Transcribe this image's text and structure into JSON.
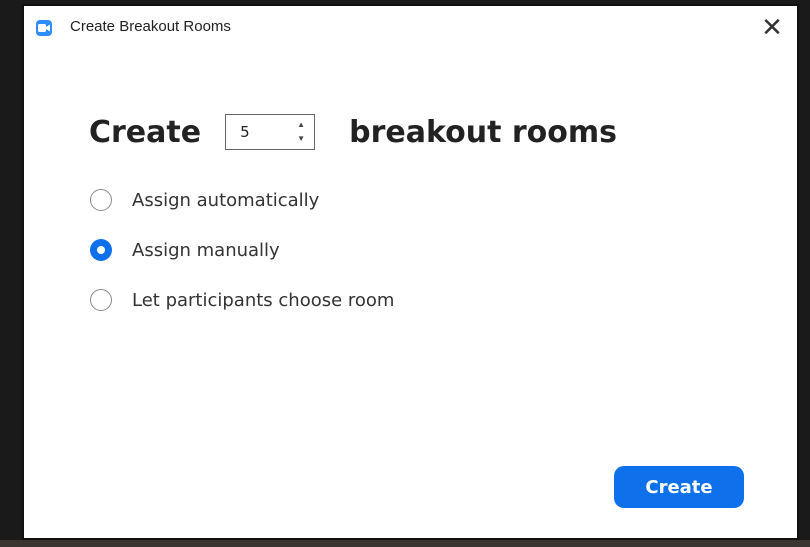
{
  "window": {
    "title": "Create Breakout Rooms",
    "close_glyph": "✕",
    "app_icon": "zoom-camera-icon"
  },
  "form": {
    "heading_prefix": "Create",
    "room_count": "5",
    "heading_suffix": "breakout rooms"
  },
  "options": [
    {
      "label": "Assign automatically",
      "checked": false
    },
    {
      "label": "Assign manually",
      "checked": true
    },
    {
      "label": "Let participants choose room",
      "checked": false
    }
  ],
  "actions": {
    "create_label": "Create"
  },
  "colors": {
    "accent": "#0e71eb",
    "app_icon": "#2d8cff"
  }
}
